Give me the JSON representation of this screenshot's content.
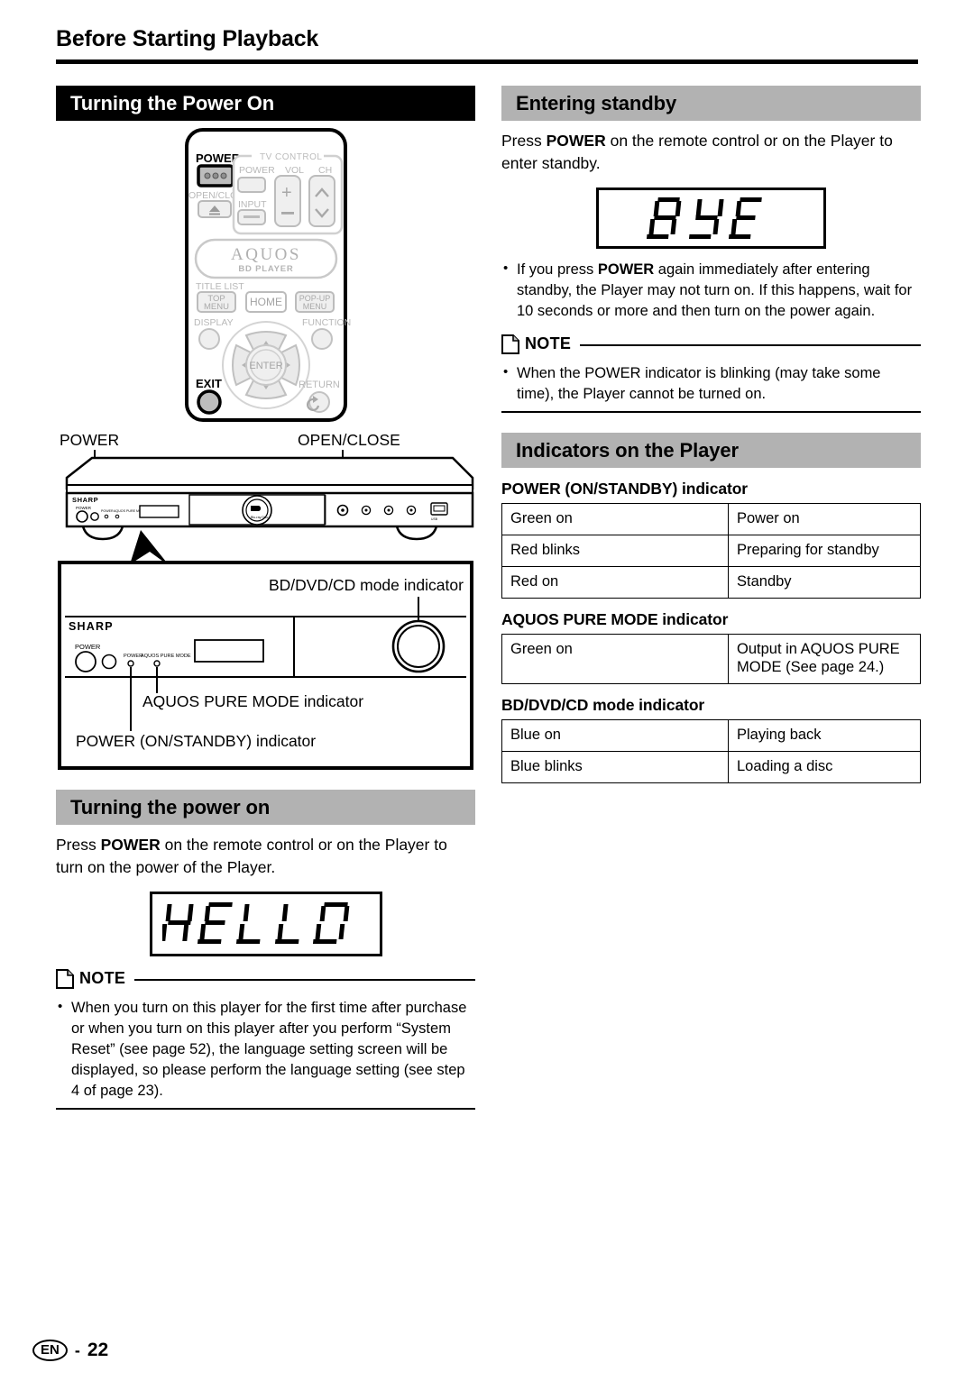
{
  "page": {
    "chapter_title": "Before Starting Playback",
    "footer_lang": "EN",
    "footer_dash": "-",
    "footer_page": "22"
  },
  "colors": {
    "bar_black": "#000000",
    "bar_gray": "#b2b2b2",
    "text": "#000000",
    "page_bg": "#ffffff"
  },
  "left": {
    "section1": {
      "heading": "Turning the Power On",
      "remote": {
        "power_label": "POWER",
        "open_close_label": "OPEN/CLOSE",
        "tv_control_label": "TV CONTROL",
        "tv_power_label": "POWER",
        "tv_vol_label": "VOL",
        "tv_ch_label": "CH",
        "tv_input_label": "INPUT",
        "vol_plus": "+",
        "vol_minus": "−",
        "brand": "AQUOS",
        "brand_sub": "BD PLAYER",
        "title_list_label": "TITLE LIST",
        "top_menu_line1": "TOP",
        "top_menu_line2": "MENU",
        "home_label": "HOME",
        "popup_line1": "POP-UP",
        "popup_line2": "MENU",
        "display_label": "DISPLAY",
        "function_label": "FUNCTION",
        "enter_label": "ENTER",
        "exit_label": "EXIT",
        "return_label": "RETURN"
      },
      "player_callouts": {
        "power": "POWER",
        "open_close": "OPEN/CLOSE",
        "brand": "SHARP",
        "front_power": "POWER",
        "led_power": "POWER",
        "led_aquos": "AQUOS PURE MODE",
        "bd_mode_indicator": "BD/DVD/CD mode indicator",
        "aquos_pure_indicator": "AQUOS PURE MODE indicator",
        "power_onstandby_indicator": "POWER (ON/STANDBY) indicator"
      }
    },
    "section2": {
      "heading": "Turning the power on",
      "paragraph_pre": "Press ",
      "paragraph_bold": "POWER",
      "paragraph_post": " on the remote control or on the Player to turn on the power of the Player.",
      "lcd_text": "HELLO",
      "note_label": "NOTE",
      "note_items": [
        "When you turn on this player for the first time after purchase or when you turn on this player after you perform “System Reset” (see page 52), the language setting screen will be displayed, so please perform the language setting (see step 4 of page 23)."
      ]
    }
  },
  "right": {
    "section1": {
      "heading": "Entering standby",
      "paragraph_pre": "Press ",
      "paragraph_bold": "POWER",
      "paragraph_post": " on the remote control or on the Player to enter standby.",
      "lcd_text": "BYE",
      "bullets": [
        {
          "pre": "If you press ",
          "bold": "POWER",
          "post": " again immediately after entering standby, the Player may not turn on. If this happens, wait for 10 seconds or more and then turn on the power again."
        }
      ],
      "note_label": "NOTE",
      "note_items": [
        "When the POWER indicator is blinking (may take some time), the Player cannot be turned on."
      ]
    },
    "section2": {
      "heading": "Indicators on the Player",
      "tables": [
        {
          "title": "POWER (ON/STANDBY) indicator",
          "rows": [
            [
              "Green on",
              "Power on"
            ],
            [
              "Red blinks",
              "Preparing for standby"
            ],
            [
              "Red on",
              "Standby"
            ]
          ]
        },
        {
          "title": "AQUOS PURE MODE indicator",
          "rows": [
            [
              "Green on",
              "Output in AQUOS PURE MODE (See page 24.)"
            ]
          ]
        },
        {
          "title": "BD/DVD/CD mode indicator",
          "rows": [
            [
              "Blue on",
              "Playing back"
            ],
            [
              "Blue blinks",
              "Loading a disc"
            ]
          ]
        }
      ]
    }
  },
  "icons": {
    "note": "note-page-icon",
    "eject": "eject-icon",
    "arrow_up": "arrow-up-icon",
    "arrow_down": "arrow-down-icon",
    "arrow_left": "arrow-left-icon",
    "arrow_right": "arrow-right-icon",
    "return": "return-arrow-icon",
    "bluray_disc": "bluray-disc-icon"
  }
}
